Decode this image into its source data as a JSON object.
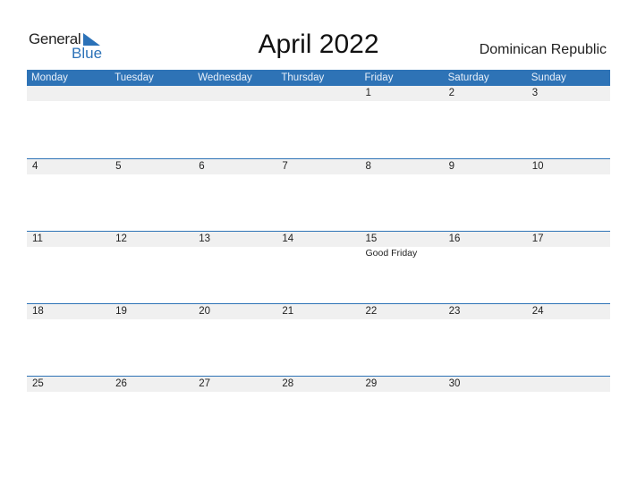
{
  "logo": {
    "word1": "General",
    "word2": "Blue"
  },
  "title": "April 2022",
  "country": "Dominican Republic",
  "colors": {
    "accent": "#2e73b6",
    "band": "#f0f0f0"
  },
  "weekdays": [
    "Monday",
    "Tuesday",
    "Wednesday",
    "Thursday",
    "Friday",
    "Saturday",
    "Sunday"
  ],
  "weeks": [
    {
      "days": [
        "",
        "",
        "",
        "",
        "1",
        "2",
        "3"
      ],
      "holidays": [
        "",
        "",
        "",
        "",
        "",
        "",
        ""
      ]
    },
    {
      "days": [
        "4",
        "5",
        "6",
        "7",
        "8",
        "9",
        "10"
      ],
      "holidays": [
        "",
        "",
        "",
        "",
        "",
        "",
        ""
      ]
    },
    {
      "days": [
        "11",
        "12",
        "13",
        "14",
        "15",
        "16",
        "17"
      ],
      "holidays": [
        "",
        "",
        "",
        "",
        "Good Friday",
        "",
        ""
      ]
    },
    {
      "days": [
        "18",
        "19",
        "20",
        "21",
        "22",
        "23",
        "24"
      ],
      "holidays": [
        "",
        "",
        "",
        "",
        "",
        "",
        ""
      ]
    },
    {
      "days": [
        "25",
        "26",
        "27",
        "28",
        "29",
        "30",
        ""
      ],
      "holidays": [
        "",
        "",
        "",
        "",
        "",
        "",
        ""
      ]
    }
  ]
}
